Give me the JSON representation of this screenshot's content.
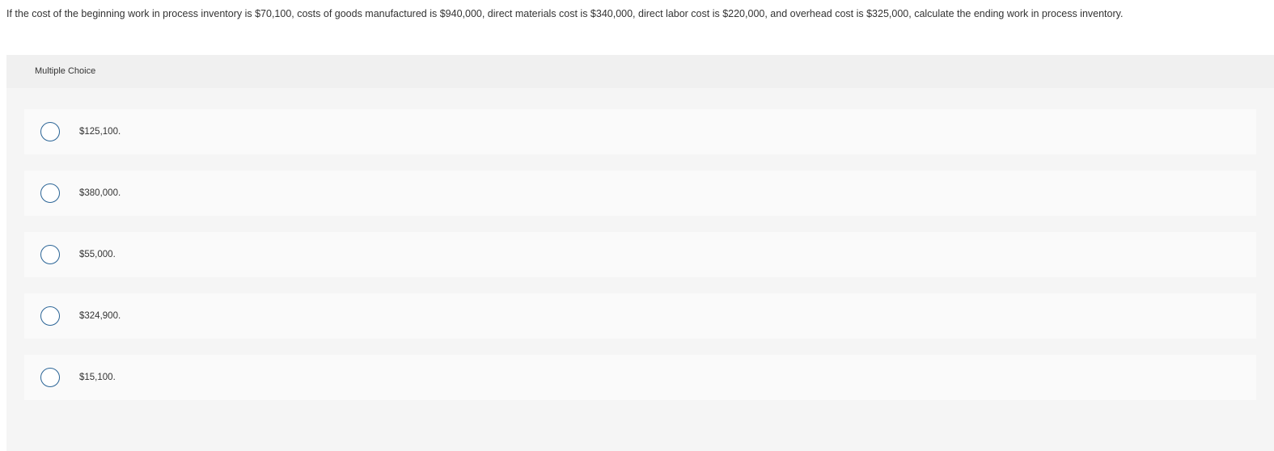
{
  "question": {
    "text": "If the cost of the beginning work in process inventory is $70,100, costs of goods manufactured is $940,000, direct materials cost is $340,000, direct labor cost is $220,000, and overhead cost is $325,000, calculate the ending work in process inventory."
  },
  "panel": {
    "header_label": "Multiple Choice",
    "options": [
      {
        "label": "$125,100."
      },
      {
        "label": "$380,000."
      },
      {
        "label": "$55,000."
      },
      {
        "label": "$324,900."
      },
      {
        "label": "$15,100."
      }
    ]
  },
  "colors": {
    "radio_border": "#2a6496",
    "panel_bg": "#f5f5f5",
    "header_bg": "#f0f0f0",
    "option_bg": "#fafafa"
  }
}
